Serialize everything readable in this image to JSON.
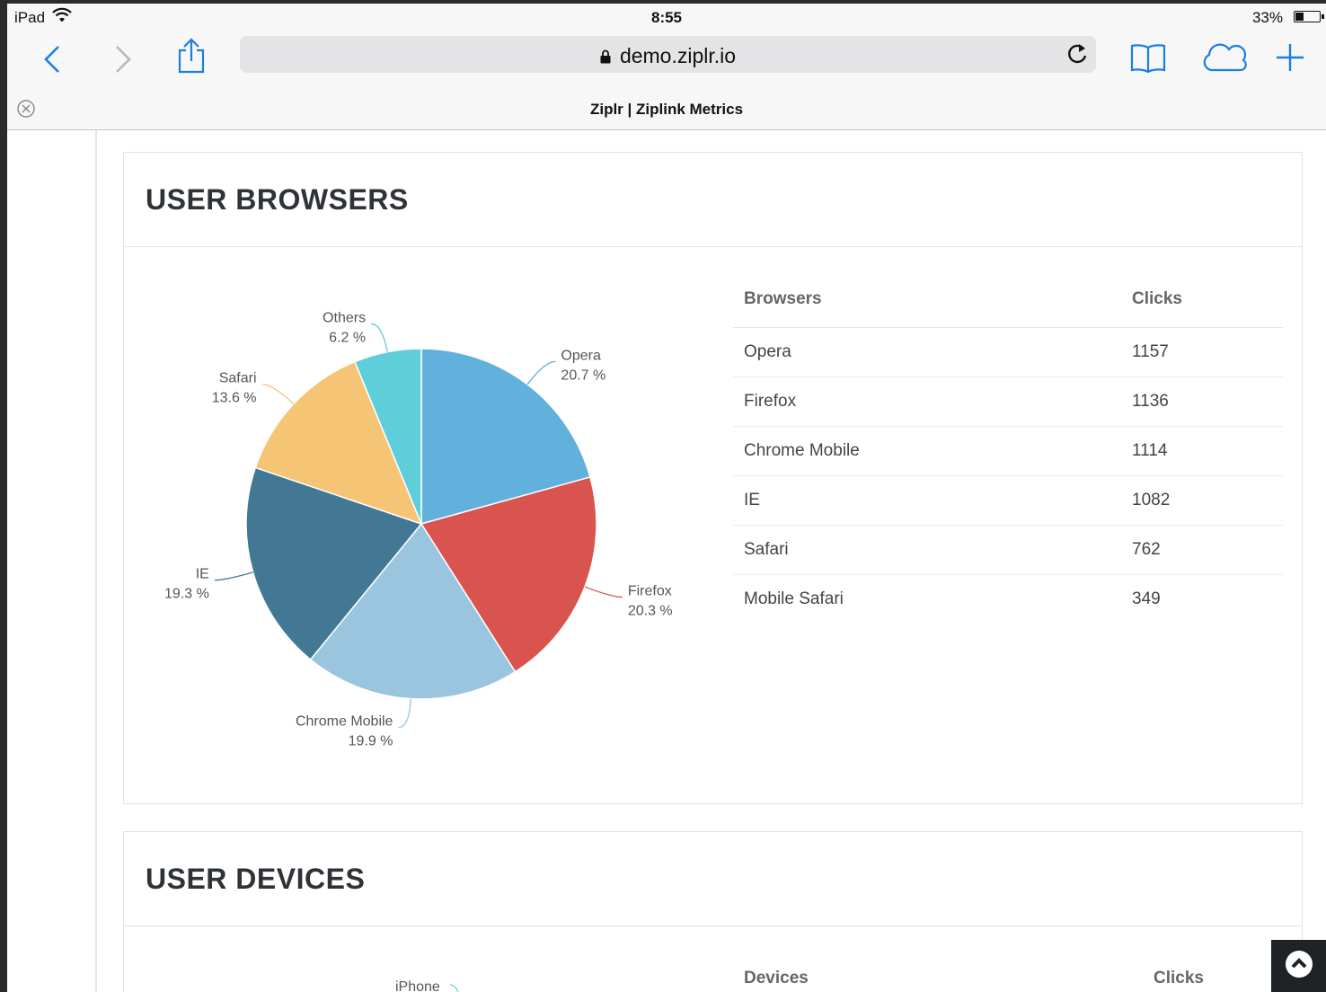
{
  "status_bar": {
    "device": "iPad",
    "time": "8:55",
    "battery": "33%"
  },
  "browser": {
    "url": "demo.ziplr.io",
    "tab_title": "Ziplr | Ziplink Metrics"
  },
  "icons": {
    "back": "chevron-left-icon",
    "forward": "chevron-right-icon",
    "share": "share-icon",
    "lock": "lock-icon",
    "reload": "reload-icon",
    "bookmarks": "book-icon",
    "cloud": "cloud-icon",
    "new_tab": "plus-icon",
    "close_tab": "close-icon",
    "scroll_top": "arrow-up-circle-icon"
  },
  "browsers_section": {
    "title": "USER BROWSERS",
    "table_headers": [
      "Browsers",
      "Clicks"
    ],
    "rows": [
      {
        "name": "Opera",
        "clicks": "1157"
      },
      {
        "name": "Firefox",
        "clicks": "1136"
      },
      {
        "name": "Chrome Mobile",
        "clicks": "1114"
      },
      {
        "name": "IE",
        "clicks": "1082"
      },
      {
        "name": "Safari",
        "clicks": "762"
      },
      {
        "name": "Mobile Safari",
        "clicks": "349"
      }
    ]
  },
  "devices_section": {
    "title": "USER DEVICES",
    "table_headers": [
      "Devices",
      "Clicks"
    ],
    "pie_first_label": "iPhone"
  },
  "chart_data": {
    "type": "pie",
    "slices": [
      {
        "label": "Opera",
        "value": 20.7,
        "display": "20.7 %",
        "color": "#62b0dc"
      },
      {
        "label": "Firefox",
        "value": 20.3,
        "display": "20.3 %",
        "color": "#d9534f"
      },
      {
        "label": "Chrome Mobile",
        "value": 19.9,
        "display": "19.9 %",
        "color": "#9ac5de"
      },
      {
        "label": "IE",
        "value": 19.3,
        "display": "19.3 %",
        "color": "#437895"
      },
      {
        "label": "Safari",
        "value": 13.6,
        "display": "13.6 %",
        "color": "#f6c475"
      },
      {
        "label": "Others",
        "value": 6.2,
        "display": "6.2 %",
        "color": "#5ecedb"
      }
    ]
  }
}
